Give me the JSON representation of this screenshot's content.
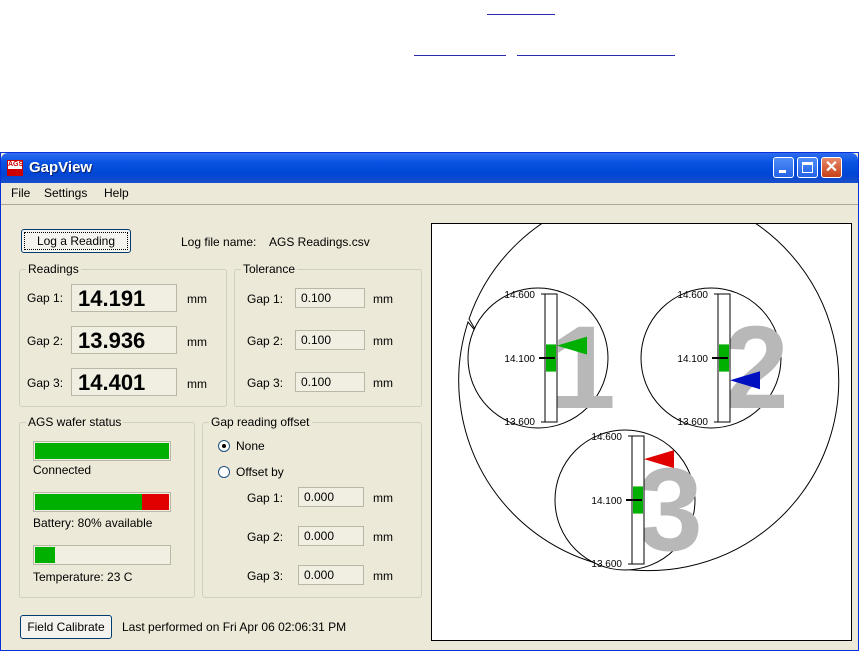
{
  "window": {
    "title": "GapView",
    "accent_color": "#0a54e3",
    "controls": [
      "minimize-icon",
      "maximize-icon",
      "close-icon"
    ]
  },
  "menu": [
    "File",
    "Settings",
    "Help"
  ],
  "toolbar": {
    "log_button": "Log a Reading",
    "log_file_label": "Log file name:",
    "log_file_name": "AGS Readings.csv"
  },
  "readings": {
    "title": "Readings",
    "unit": "mm",
    "gaps": [
      {
        "label": "Gap 1:",
        "value": "14.191"
      },
      {
        "label": "Gap 2:",
        "value": "13.936"
      },
      {
        "label": "Gap 3:",
        "value": "14.401"
      }
    ]
  },
  "tolerance": {
    "title": "Tolerance",
    "unit": "mm",
    "gaps": [
      {
        "label": "Gap 1:",
        "value": "0.100"
      },
      {
        "label": "Gap 2:",
        "value": "0.100"
      },
      {
        "label": "Gap 3:",
        "value": "0.100"
      }
    ]
  },
  "wafer_status": {
    "title": "AGS wafer status",
    "connection": {
      "label": "Connected",
      "level": 1.0,
      "color": "#00b000"
    },
    "battery": {
      "label": "Battery: 80% available",
      "level": 0.8,
      "color": "#00b000",
      "remaining_color": "#e00000"
    },
    "temperature": {
      "label": "Temperature: 23 C",
      "level": 0.15,
      "color": "#00b000"
    }
  },
  "offset": {
    "title": "Gap reading offset",
    "options": [
      {
        "label": "None",
        "selected": true
      },
      {
        "label": "Offset by",
        "selected": false
      }
    ],
    "unit": "mm",
    "gaps": [
      {
        "label": "Gap 1:",
        "value": "0.000"
      },
      {
        "label": "Gap 2:",
        "value": "0.000"
      },
      {
        "label": "Gap 3:",
        "value": "0.000"
      }
    ]
  },
  "calibration": {
    "button": "Field Calibrate",
    "status": "Last performed on Fri Apr 06 02:06:31 PM"
  },
  "gauges": [
    {
      "number": "1",
      "top": "14.600",
      "mid": "14.100",
      "bottom": "13.600",
      "reading": 14.191,
      "pointer_color": "#00b000"
    },
    {
      "number": "2",
      "top": "14.600",
      "mid": "14.100",
      "bottom": "13.600",
      "reading": 13.936,
      "pointer_color": "#0010c0"
    },
    {
      "number": "3",
      "top": "14.600",
      "mid": "14.100",
      "bottom": "13.600",
      "reading": 14.401,
      "pointer_color": "#e00000"
    }
  ],
  "gauge_scale": {
    "min": 13.6,
    "max": 14.6,
    "nominal": 14.1,
    "tolerance": 0.1,
    "band_color": "#00b000",
    "numeral_color": "#b8b8b8"
  }
}
